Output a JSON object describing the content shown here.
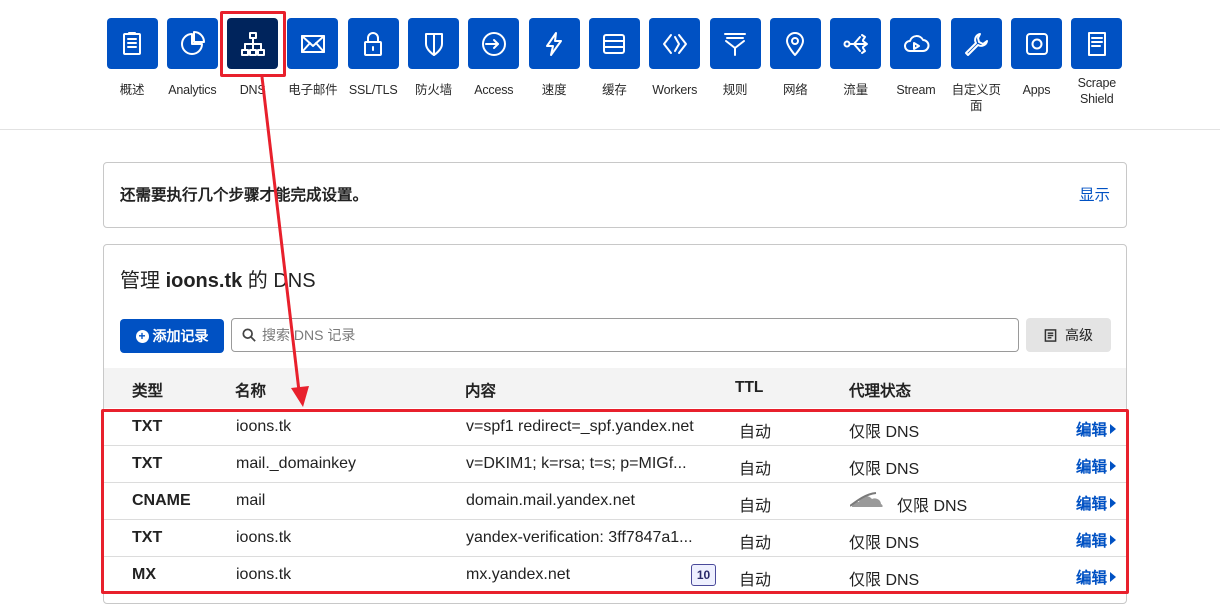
{
  "nav": {
    "items": [
      {
        "label": "概述",
        "icon": "overview-icon"
      },
      {
        "label": "Analytics",
        "icon": "analytics-icon"
      },
      {
        "label": "DNS",
        "icon": "dns-icon",
        "active": true
      },
      {
        "label": "电子邮件",
        "icon": "email-icon"
      },
      {
        "label": "SSL/TLS",
        "icon": "lock-icon"
      },
      {
        "label": "防火墙",
        "icon": "shield-icon"
      },
      {
        "label": "Access",
        "icon": "access-icon"
      },
      {
        "label": "速度",
        "icon": "lightning-icon"
      },
      {
        "label": "缓存",
        "icon": "cache-icon"
      },
      {
        "label": "Workers",
        "icon": "workers-icon"
      },
      {
        "label": "规则",
        "icon": "filter-icon"
      },
      {
        "label": "网络",
        "icon": "location-icon"
      },
      {
        "label": "流量",
        "icon": "traffic-icon"
      },
      {
        "label": "Stream",
        "icon": "stream-icon"
      },
      {
        "label": "自定义页面",
        "icon": "wrench-icon"
      },
      {
        "label": "Apps",
        "icon": "apps-icon"
      },
      {
        "label": "Scrape Shield",
        "label_line1": "Scrape",
        "label_line2": "Shield",
        "icon": "document-icon"
      }
    ]
  },
  "setup": {
    "text": "还需要执行几个步骤才能完成设置。",
    "show_link": "显示"
  },
  "dns": {
    "title_prefix": "管理",
    "domain": "ioons.tk",
    "title_suffix": "的 DNS",
    "add_button": "添加记录",
    "search_placeholder": "搜索 DNS 记录",
    "advanced_button": "高级",
    "columns": {
      "type": "类型",
      "name": "名称",
      "content": "内容",
      "ttl": "TTL",
      "proxy": "代理状态"
    },
    "edit_label": "编辑",
    "records": [
      {
        "type": "TXT",
        "name": "ioons.tk",
        "content": "v=spf1 redirect=_spf.yandex.net",
        "ttl": "自动",
        "proxy": "仅限 DNS"
      },
      {
        "type": "TXT",
        "name": "mail._domainkey",
        "content": "v=DKIM1; k=rsa; t=s; p=MIGf...",
        "ttl": "自动",
        "proxy": "仅限 DNS"
      },
      {
        "type": "CNAME",
        "name": "mail",
        "content": "domain.mail.yandex.net",
        "ttl": "自动",
        "proxy": "仅限 DNS",
        "cloud": true
      },
      {
        "type": "TXT",
        "name": "ioons.tk",
        "content": "yandex-verification: 3ff7847a1...",
        "ttl": "自动",
        "proxy": "仅限 DNS"
      },
      {
        "type": "MX",
        "name": "ioons.tk",
        "content": "mx.yandex.net",
        "priority": "10",
        "ttl": "自动",
        "proxy": "仅限 DNS"
      }
    ]
  },
  "colors": {
    "brand": "#0051c3",
    "active_tile": "#00245c",
    "annotation": "#e8202c"
  }
}
